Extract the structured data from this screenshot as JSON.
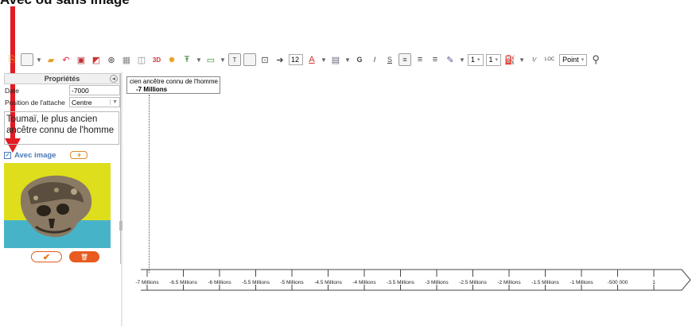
{
  "header": {
    "title": "Avec ou sans image"
  },
  "toolbar": {
    "font_size": "12",
    "bold": "G",
    "italic": "I",
    "underline": "S",
    "line_width_1": "1",
    "line_width_2": "1",
    "loc_label": "LOC",
    "unit_select": "Point"
  },
  "panel": {
    "title": "Propriétés",
    "fields": [
      {
        "label": "Date",
        "value": "-7000"
      },
      {
        "label": "Position de l'attache",
        "value": "Centre"
      }
    ],
    "description": "Toumaï, le plus ancien ancêtre connu de l'homme",
    "with_image_label": "Avec image",
    "with_image_checked": true
  },
  "event": {
    "title": "cien ancêtre connu de l'homme",
    "date_label": "-7 Millions"
  },
  "timeline": {
    "ticks": [
      "-7 Millions",
      "-6.5 Millions",
      "-6 Millions",
      "-5.5 Millions",
      "-5 Millions",
      "-4.5 Millions",
      "-4 Millions",
      "-3.5 Millions",
      "-3 Millions",
      "-2.5 Millions",
      "-2 Millions",
      "-1.5 Millions",
      "-1 Millions",
      "-500 000",
      "1"
    ]
  },
  "colors": {
    "annotation_arrow": "#e31b23",
    "accent_orange": "#e8771b",
    "image_background": "#dede1c",
    "image_water": "#47b3c9"
  }
}
